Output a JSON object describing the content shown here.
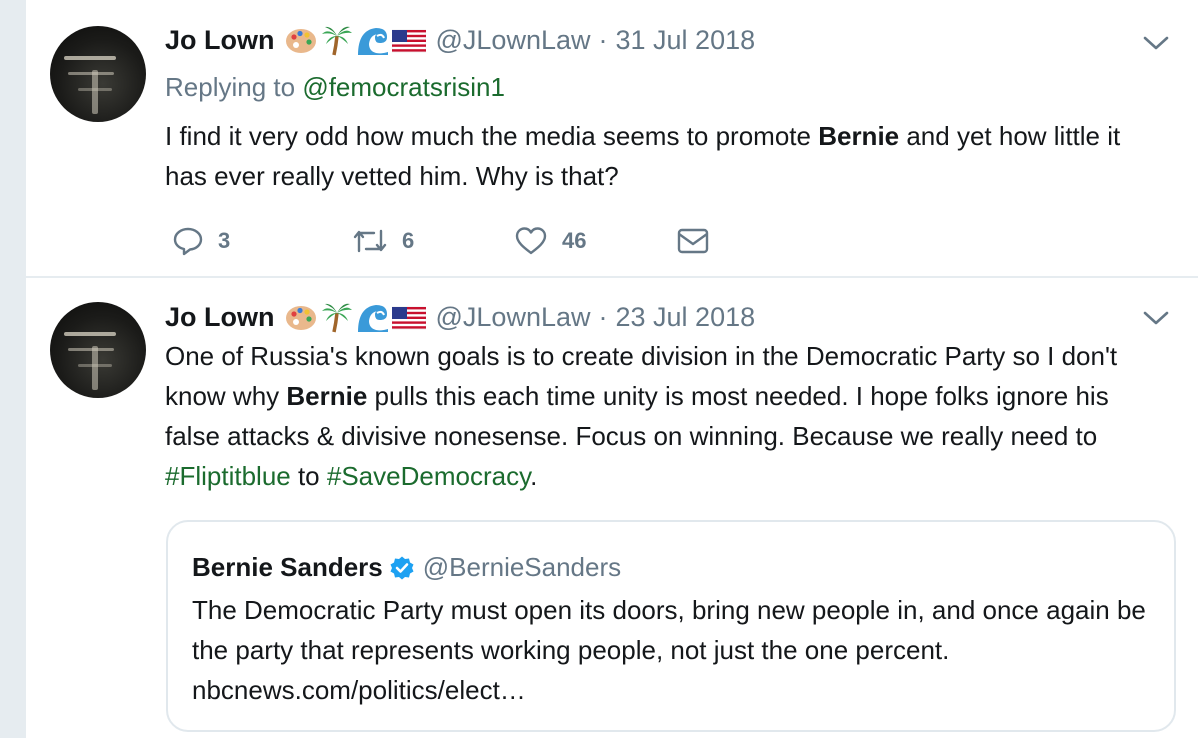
{
  "tweets": [
    {
      "name": "Jo Lown",
      "emojis": [
        "artist-palette-icon",
        "palm-tree-icon",
        "wave-icon",
        "us-flag-icon"
      ],
      "handle": "@JLownLaw",
      "separator": "·",
      "date": "31 Jul 2018",
      "replying_prefix": "Replying to",
      "replying_handle": "@femocratsrisin1",
      "text_1": "I find it very odd how much the media seems to promote ",
      "text_bold": "Bernie",
      "text_2": " and yet how little it has ever really vetted him. Why is that?",
      "replies": "3",
      "retweets": "6",
      "likes": "46"
    },
    {
      "name": "Jo Lown",
      "emojis": [
        "artist-palette-icon",
        "palm-tree-icon",
        "wave-icon",
        "us-flag-icon"
      ],
      "handle": "@JLownLaw",
      "separator": "·",
      "date": "23 Jul 2018",
      "text_1": "One of Russia's known goals is to create division in the Democratic Party so I don't know why ",
      "text_bold": "Bernie",
      "text_2": " pulls this each time unity is most needed. I hope folks ignore his false attacks & divisive nonesense. Focus on winning. Because we really need to ",
      "hashtag_1": "#Fliptitblue",
      "text_3": " to ",
      "hashtag_2": "#SaveDemocracy",
      "text_4": ".",
      "quote": {
        "name": "Bernie Sanders",
        "handle": "@BernieSanders",
        "text": "The Democratic Party must open its doors, bring new people in, and once again be the party that represents working people, not just the one percent.",
        "link": "nbcnews.com/politics/elect…"
      }
    }
  ],
  "colors": {
    "background": "#e6ecf0",
    "text": "#14171a",
    "secondary": "#657786",
    "link": "#1b6b2e",
    "verified": "#1da1f2"
  }
}
